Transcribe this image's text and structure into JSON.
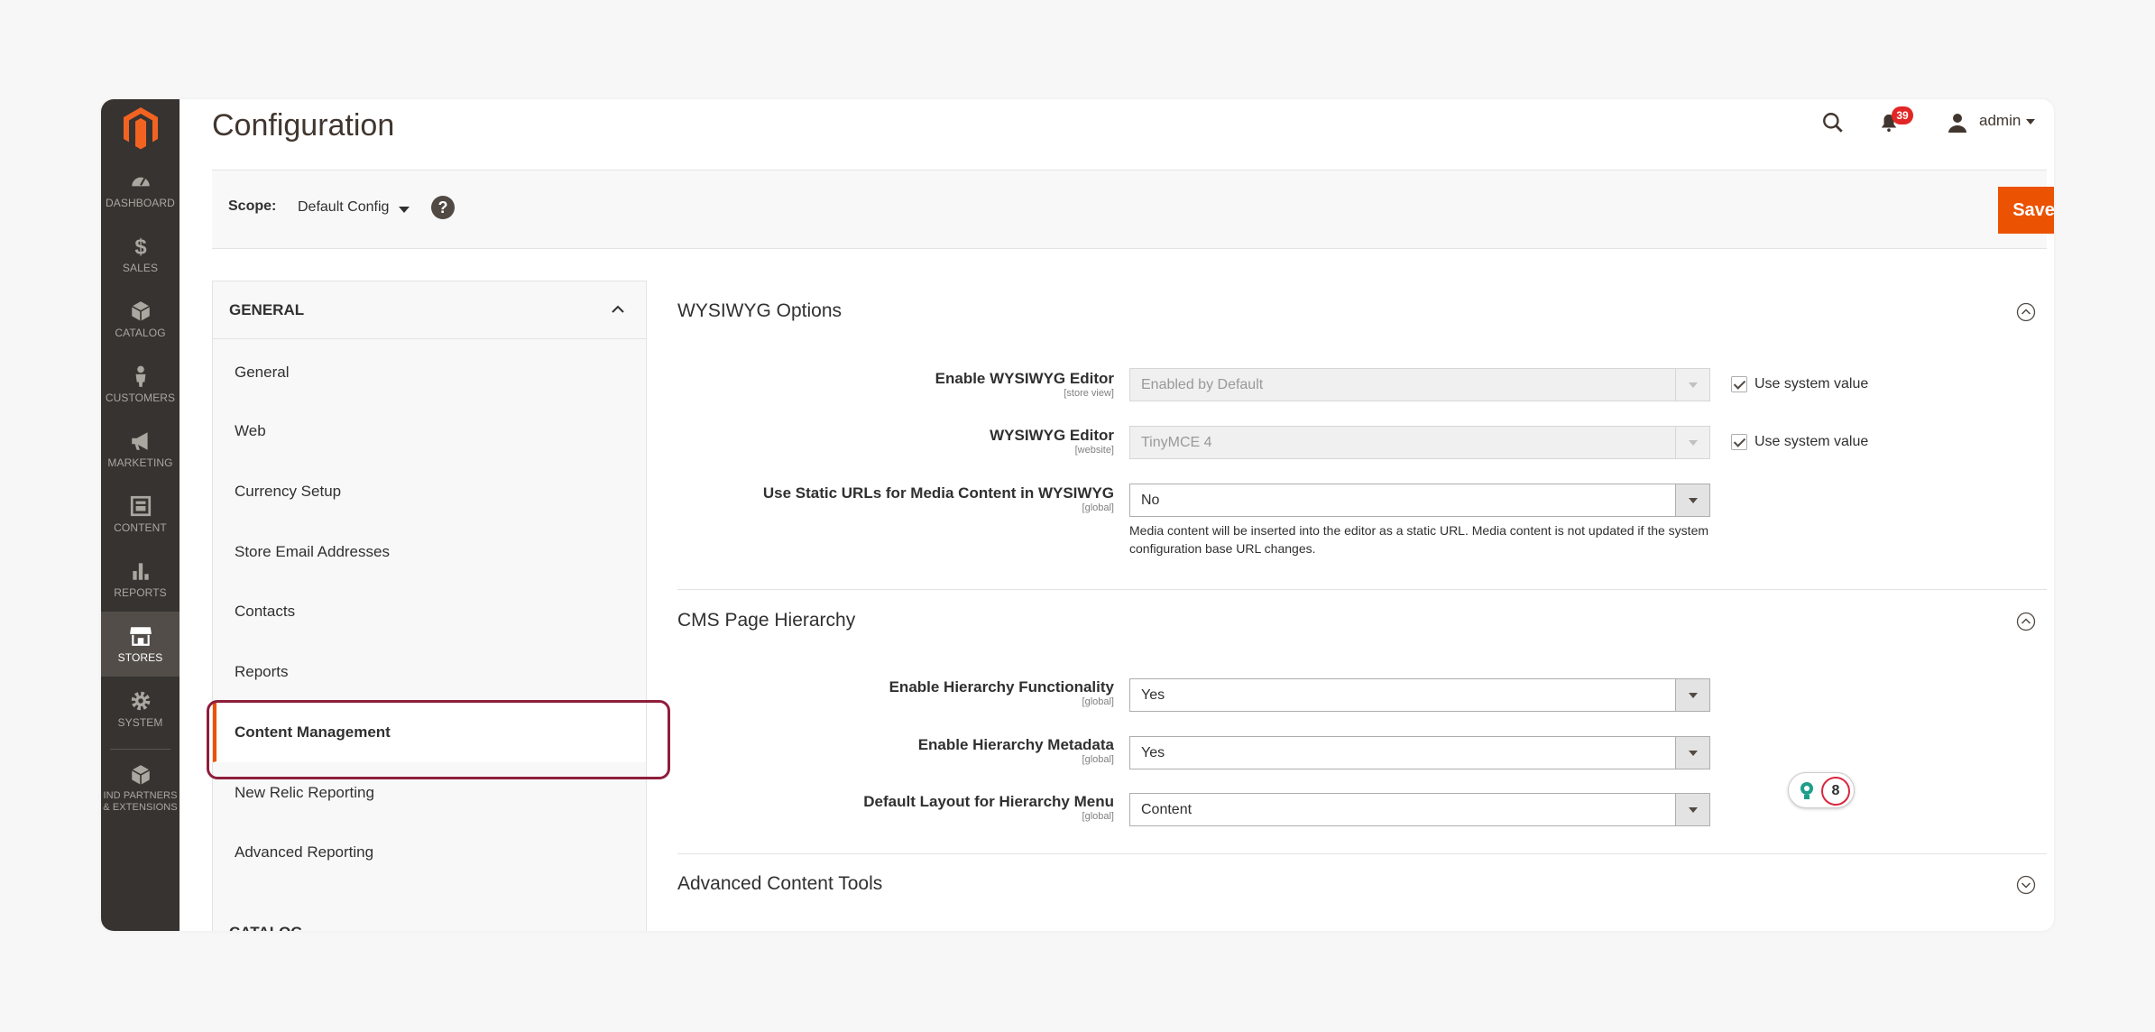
{
  "sidebar": {
    "items": [
      {
        "label": "DASHBOARD",
        "icon": "dashboard-icon"
      },
      {
        "label": "SALES",
        "icon": "dollar-icon"
      },
      {
        "label": "CATALOG",
        "icon": "cube-icon"
      },
      {
        "label": "CUSTOMERS",
        "icon": "person-icon"
      },
      {
        "label": "MARKETING",
        "icon": "megaphone-icon"
      },
      {
        "label": "CONTENT",
        "icon": "content-icon"
      },
      {
        "label": "REPORTS",
        "icon": "bar-chart-icon"
      },
      {
        "label": "STORES",
        "icon": "storefront-icon",
        "active": true
      },
      {
        "label": "SYSTEM",
        "icon": "gear-icon"
      },
      {
        "label": "IND PARTNERS & EXTENSIONS",
        "icon": "extensions-icon"
      }
    ]
  },
  "header": {
    "title": "Configuration",
    "notifications_count": "39",
    "user": "admin"
  },
  "scope": {
    "label": "Scope:",
    "value": "Default Config",
    "help": "?",
    "save_label": "Save Config"
  },
  "config_nav": {
    "group": "GENERAL",
    "items": [
      "General",
      "Web",
      "Currency Setup",
      "Store Email Addresses",
      "Contacts",
      "Reports",
      "Content Management",
      "New Relic Reporting",
      "Advanced Reporting"
    ],
    "active": "Content Management",
    "next_group": "CATALOG"
  },
  "sections": {
    "wysiwyg": {
      "title": "WYSIWYG Options",
      "fields": [
        {
          "label": "Enable WYSIWYG Editor",
          "scope": "[store view]",
          "value": "Enabled by Default",
          "use_system": "Use system value"
        },
        {
          "label": "WYSIWYG Editor",
          "scope": "[website]",
          "value": "TinyMCE 4",
          "use_system": "Use system value"
        },
        {
          "label": "Use Static URLs for Media Content in WYSIWYG",
          "scope": "[global]",
          "value": "No"
        }
      ],
      "note": "Media content will be inserted into the editor as a static URL. Media content is not updated if the system configuration base URL changes."
    },
    "cms": {
      "title": "CMS Page Hierarchy",
      "fields": [
        {
          "label": "Enable Hierarchy Functionality",
          "scope": "[global]",
          "value": "Yes"
        },
        {
          "label": "Enable Hierarchy Metadata",
          "scope": "[global]",
          "value": "Yes"
        },
        {
          "label": "Default Layout for Hierarchy Menu",
          "scope": "[global]",
          "value": "Content"
        }
      ]
    },
    "advanced": {
      "title": "Advanced Content Tools"
    }
  },
  "widget": {
    "count": "8"
  },
  "colors": {
    "accent": "#eb5202",
    "sidebar": "#373330",
    "highlight": "#8e1e3a"
  }
}
